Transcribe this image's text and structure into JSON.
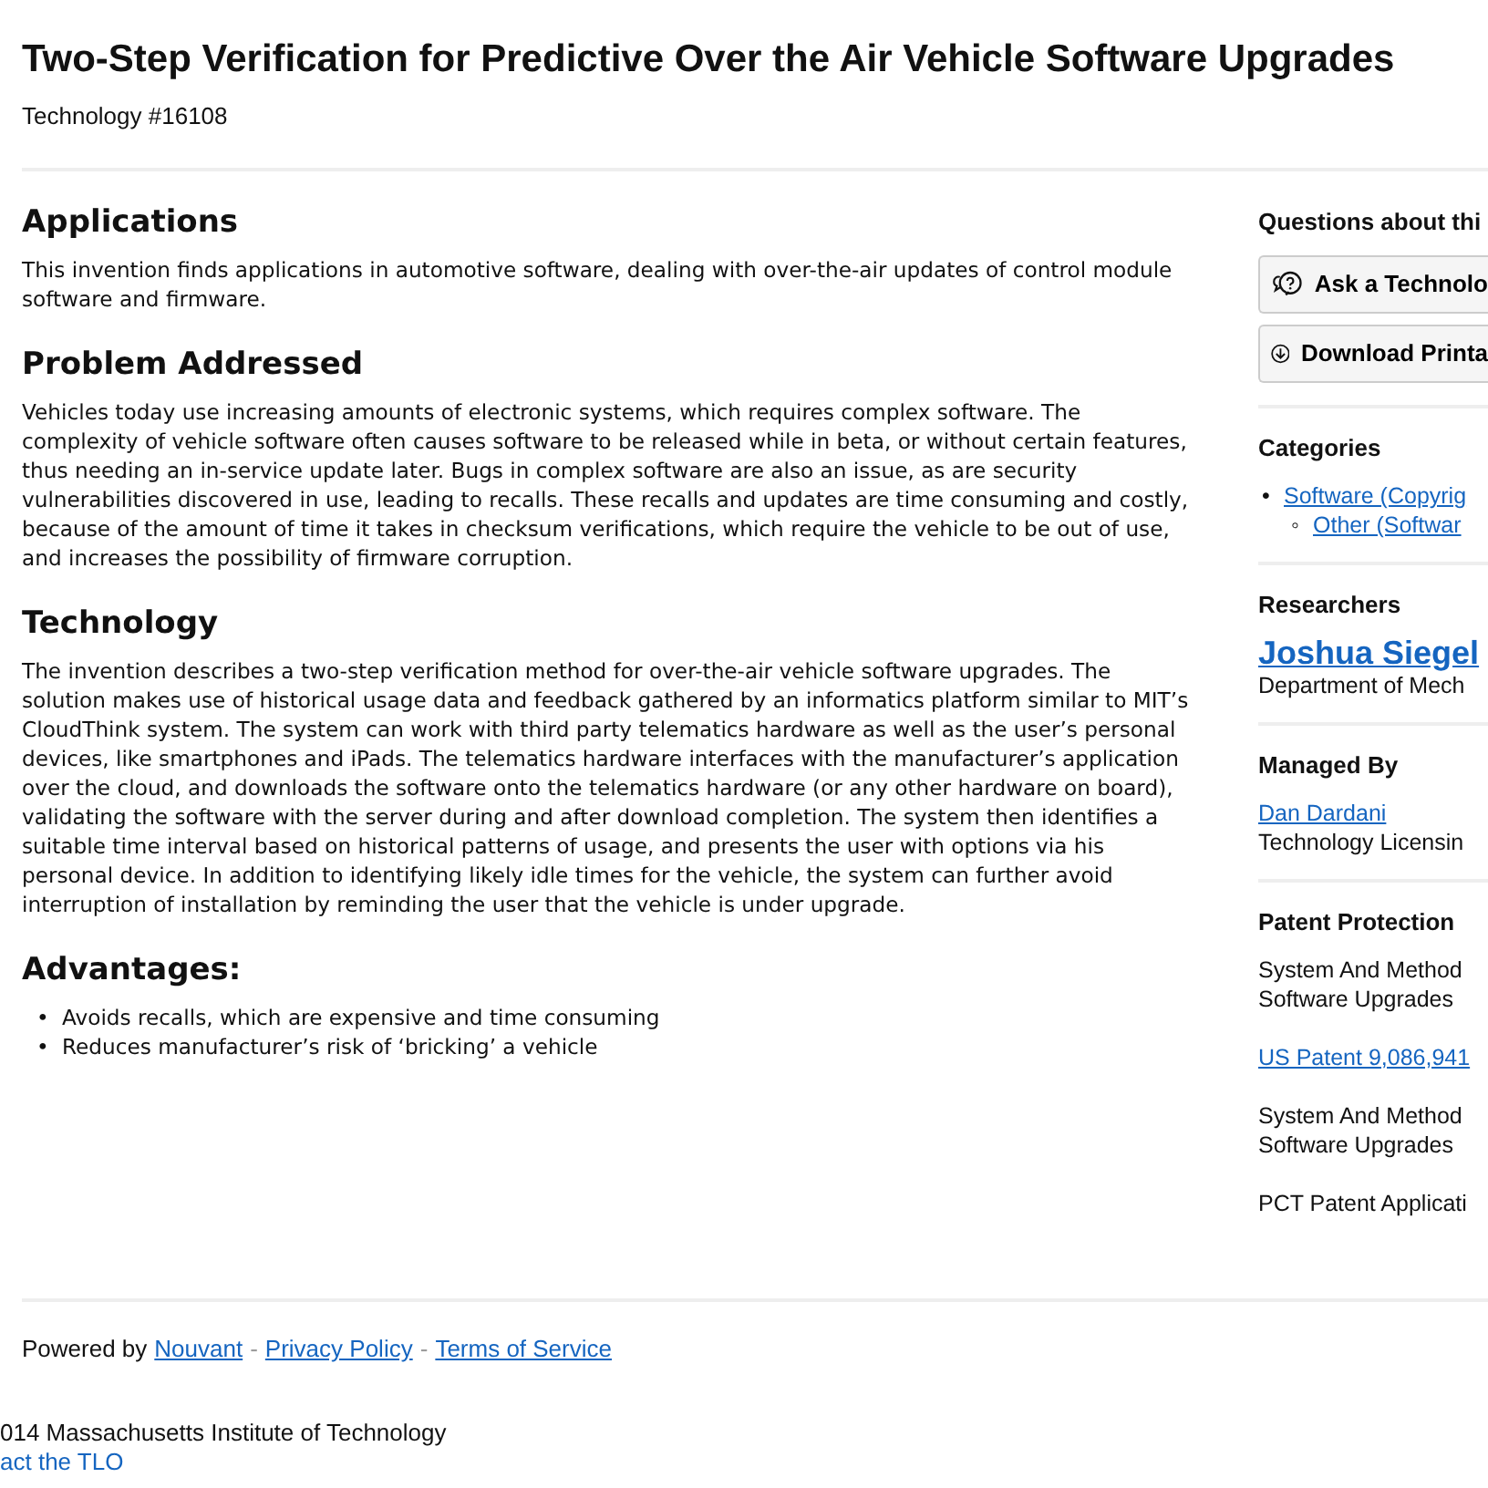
{
  "title": "Two-Step Verification for Predictive Over the Air Vehicle Software Upgrades",
  "tech_number": "Technology #16108",
  "sections": [
    {
      "heading": "Applications",
      "kind": "paragraph",
      "text": "This invention finds applications in automotive software, dealing with over-the-air updates of control module software and firmware."
    },
    {
      "heading": "Problem Addressed",
      "kind": "paragraph",
      "text": "Vehicles today use increasing amounts of electronic systems, which requires complex software. The complexity of vehicle software often causes software to be released while in beta, or without certain features, thus needing an in-service update later. Bugs in complex software are also an issue, as are security vulnerabilities discovered in use, leading to recalls. These recalls and updates are time consuming and costly, because of the amount of time it takes in checksum verifications, which require the vehicle to be out of use, and increases the possibility of firmware corruption."
    },
    {
      "heading": "Technology",
      "kind": "paragraph",
      "text": "The invention describes a two-step verification method for over-the-air vehicle software upgrades. The solution makes use of historical usage data and feedback gathered by an informatics platform similar to MIT’s CloudThink system. The system can work with third party telematics hardware as well as the user’s personal devices, like smartphones and iPads. The telematics hardware interfaces with the manufacturer’s application over the cloud, and downloads the software onto the telematics hardware (or any other hardware on board), validating the software with the server during and after download completion. The system then identifies a suitable time interval based on historical patterns of usage, and presents the user with options via his personal device. In addition to identifying likely idle times for the vehicle, the system can further avoid interruption of installation by reminding the user that the vehicle is under upgrade."
    },
    {
      "heading": "Advantages:",
      "kind": "list",
      "items": [
        {
          "marker": "•",
          "text": "Avoids recalls, which are expensive and time consuming"
        },
        {
          "marker": "•",
          "text": "Reduces manufacturer’s risk of ‘bricking’ a vehicle"
        }
      ]
    }
  ],
  "sidebar": {
    "questions_heading": "Questions about thi",
    "buttons": [
      {
        "label": "Ask a Technolo",
        "kind": "ask"
      },
      {
        "label": "Download Printa",
        "kind": "download"
      }
    ],
    "categories": {
      "heading": "Categories",
      "items": [
        {
          "marker": "•",
          "label": "Software (Copyrig",
          "children": [
            {
              "marker": "◦",
              "label": "Other (Softwar"
            }
          ]
        }
      ]
    },
    "researchers": {
      "heading": "Researchers",
      "name": "Joshua Siegel",
      "department": "Department of Mech"
    },
    "managed_by": {
      "heading": "Managed By",
      "name": "Dan Dardani",
      "office": "Technology Licensin"
    },
    "patents": {
      "heading": "Patent Protection",
      "entries": [
        {
          "title": "System And Method\nSoftware Upgrades",
          "link": "US Patent 9,086,941"
        },
        {
          "title": "System And Method\nSoftware Upgrades"
        },
        {
          "title": "PCT Patent Applicati"
        }
      ]
    }
  },
  "footer": {
    "powered_by": "Powered by",
    "links": [
      "Nouvant",
      "Privacy Policy",
      "Terms of Service"
    ],
    "separator": "-",
    "copyright": "014 Massachusetts Institute of Technology",
    "contact": "act the TLO"
  }
}
